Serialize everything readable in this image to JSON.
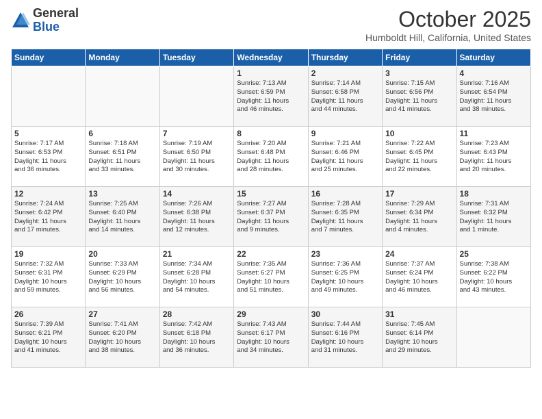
{
  "logo": {
    "line1": "General",
    "line2": "Blue"
  },
  "header": {
    "title": "October 2025",
    "location": "Humboldt Hill, California, United States"
  },
  "weekdays": [
    "Sunday",
    "Monday",
    "Tuesday",
    "Wednesday",
    "Thursday",
    "Friday",
    "Saturday"
  ],
  "weeks": [
    [
      {
        "day": "",
        "info": ""
      },
      {
        "day": "",
        "info": ""
      },
      {
        "day": "",
        "info": ""
      },
      {
        "day": "1",
        "info": "Sunrise: 7:13 AM\nSunset: 6:59 PM\nDaylight: 11 hours\nand 46 minutes."
      },
      {
        "day": "2",
        "info": "Sunrise: 7:14 AM\nSunset: 6:58 PM\nDaylight: 11 hours\nand 44 minutes."
      },
      {
        "day": "3",
        "info": "Sunrise: 7:15 AM\nSunset: 6:56 PM\nDaylight: 11 hours\nand 41 minutes."
      },
      {
        "day": "4",
        "info": "Sunrise: 7:16 AM\nSunset: 6:54 PM\nDaylight: 11 hours\nand 38 minutes."
      }
    ],
    [
      {
        "day": "5",
        "info": "Sunrise: 7:17 AM\nSunset: 6:53 PM\nDaylight: 11 hours\nand 36 minutes."
      },
      {
        "day": "6",
        "info": "Sunrise: 7:18 AM\nSunset: 6:51 PM\nDaylight: 11 hours\nand 33 minutes."
      },
      {
        "day": "7",
        "info": "Sunrise: 7:19 AM\nSunset: 6:50 PM\nDaylight: 11 hours\nand 30 minutes."
      },
      {
        "day": "8",
        "info": "Sunrise: 7:20 AM\nSunset: 6:48 PM\nDaylight: 11 hours\nand 28 minutes."
      },
      {
        "day": "9",
        "info": "Sunrise: 7:21 AM\nSunset: 6:46 PM\nDaylight: 11 hours\nand 25 minutes."
      },
      {
        "day": "10",
        "info": "Sunrise: 7:22 AM\nSunset: 6:45 PM\nDaylight: 11 hours\nand 22 minutes."
      },
      {
        "day": "11",
        "info": "Sunrise: 7:23 AM\nSunset: 6:43 PM\nDaylight: 11 hours\nand 20 minutes."
      }
    ],
    [
      {
        "day": "12",
        "info": "Sunrise: 7:24 AM\nSunset: 6:42 PM\nDaylight: 11 hours\nand 17 minutes."
      },
      {
        "day": "13",
        "info": "Sunrise: 7:25 AM\nSunset: 6:40 PM\nDaylight: 11 hours\nand 14 minutes."
      },
      {
        "day": "14",
        "info": "Sunrise: 7:26 AM\nSunset: 6:38 PM\nDaylight: 11 hours\nand 12 minutes."
      },
      {
        "day": "15",
        "info": "Sunrise: 7:27 AM\nSunset: 6:37 PM\nDaylight: 11 hours\nand 9 minutes."
      },
      {
        "day": "16",
        "info": "Sunrise: 7:28 AM\nSunset: 6:35 PM\nDaylight: 11 hours\nand 7 minutes."
      },
      {
        "day": "17",
        "info": "Sunrise: 7:29 AM\nSunset: 6:34 PM\nDaylight: 11 hours\nand 4 minutes."
      },
      {
        "day": "18",
        "info": "Sunrise: 7:31 AM\nSunset: 6:32 PM\nDaylight: 11 hours\nand 1 minute."
      }
    ],
    [
      {
        "day": "19",
        "info": "Sunrise: 7:32 AM\nSunset: 6:31 PM\nDaylight: 10 hours\nand 59 minutes."
      },
      {
        "day": "20",
        "info": "Sunrise: 7:33 AM\nSunset: 6:29 PM\nDaylight: 10 hours\nand 56 minutes."
      },
      {
        "day": "21",
        "info": "Sunrise: 7:34 AM\nSunset: 6:28 PM\nDaylight: 10 hours\nand 54 minutes."
      },
      {
        "day": "22",
        "info": "Sunrise: 7:35 AM\nSunset: 6:27 PM\nDaylight: 10 hours\nand 51 minutes."
      },
      {
        "day": "23",
        "info": "Sunrise: 7:36 AM\nSunset: 6:25 PM\nDaylight: 10 hours\nand 49 minutes."
      },
      {
        "day": "24",
        "info": "Sunrise: 7:37 AM\nSunset: 6:24 PM\nDaylight: 10 hours\nand 46 minutes."
      },
      {
        "day": "25",
        "info": "Sunrise: 7:38 AM\nSunset: 6:22 PM\nDaylight: 10 hours\nand 43 minutes."
      }
    ],
    [
      {
        "day": "26",
        "info": "Sunrise: 7:39 AM\nSunset: 6:21 PM\nDaylight: 10 hours\nand 41 minutes."
      },
      {
        "day": "27",
        "info": "Sunrise: 7:41 AM\nSunset: 6:20 PM\nDaylight: 10 hours\nand 38 minutes."
      },
      {
        "day": "28",
        "info": "Sunrise: 7:42 AM\nSunset: 6:18 PM\nDaylight: 10 hours\nand 36 minutes."
      },
      {
        "day": "29",
        "info": "Sunrise: 7:43 AM\nSunset: 6:17 PM\nDaylight: 10 hours\nand 34 minutes."
      },
      {
        "day": "30",
        "info": "Sunrise: 7:44 AM\nSunset: 6:16 PM\nDaylight: 10 hours\nand 31 minutes."
      },
      {
        "day": "31",
        "info": "Sunrise: 7:45 AM\nSunset: 6:14 PM\nDaylight: 10 hours\nand 29 minutes."
      },
      {
        "day": "",
        "info": ""
      }
    ]
  ]
}
